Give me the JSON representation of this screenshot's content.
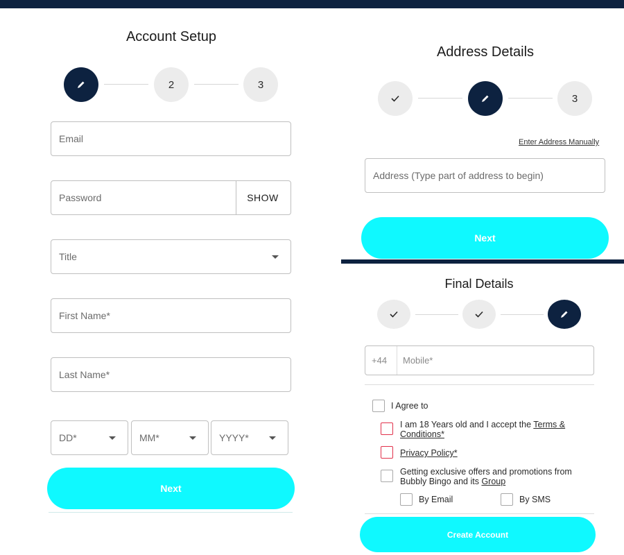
{
  "colors": {
    "navy": "#0d2240",
    "accent_cyan": "#0ff9ff",
    "error_red": "#e1304a"
  },
  "account_setup": {
    "title": "Account Setup",
    "steps": [
      {
        "type": "edit",
        "icon": "pencil-icon",
        "active": true
      },
      {
        "type": "number",
        "label": "2"
      },
      {
        "type": "number",
        "label": "3"
      }
    ],
    "email_placeholder": "Email",
    "password_placeholder": "Password",
    "show_label": "SHOW",
    "title_placeholder": "Title",
    "first_name_placeholder": "First Name*",
    "last_name_placeholder": "Last Name*",
    "dob": {
      "day": "DD*",
      "month": "MM*",
      "year": "YYYY*"
    },
    "next_label": "Next"
  },
  "address_details": {
    "title": "Address Details",
    "steps": [
      {
        "type": "done",
        "icon": "check-icon"
      },
      {
        "type": "edit",
        "icon": "pencil-icon",
        "active": true
      },
      {
        "type": "number",
        "label": "3"
      }
    ],
    "manual_link": "Enter Address Manually",
    "address_placeholder": "Address (Type part of address to begin)",
    "next_label": "Next"
  },
  "final_details": {
    "title": "Final Details",
    "steps": [
      {
        "type": "done",
        "icon": "check-icon"
      },
      {
        "type": "done",
        "icon": "check-icon"
      },
      {
        "type": "edit",
        "icon": "pencil-icon",
        "active": true
      }
    ],
    "country_code": "+44",
    "mobile_placeholder": "Mobile*",
    "agree_label": "I Agree to",
    "age_text": "I am 18 Years old and I accept the ",
    "terms_link": "Terms &",
    "conditions_link": "Conditions*",
    "privacy_link": "Privacy Policy*",
    "offers_text_line1": "Getting exclusive offers and promotions from",
    "offers_text_line2": "Bubbly Bingo and its ",
    "group_link": "Group",
    "by_email": "By Email",
    "by_sms": "By SMS",
    "create_label": "Create Account"
  }
}
